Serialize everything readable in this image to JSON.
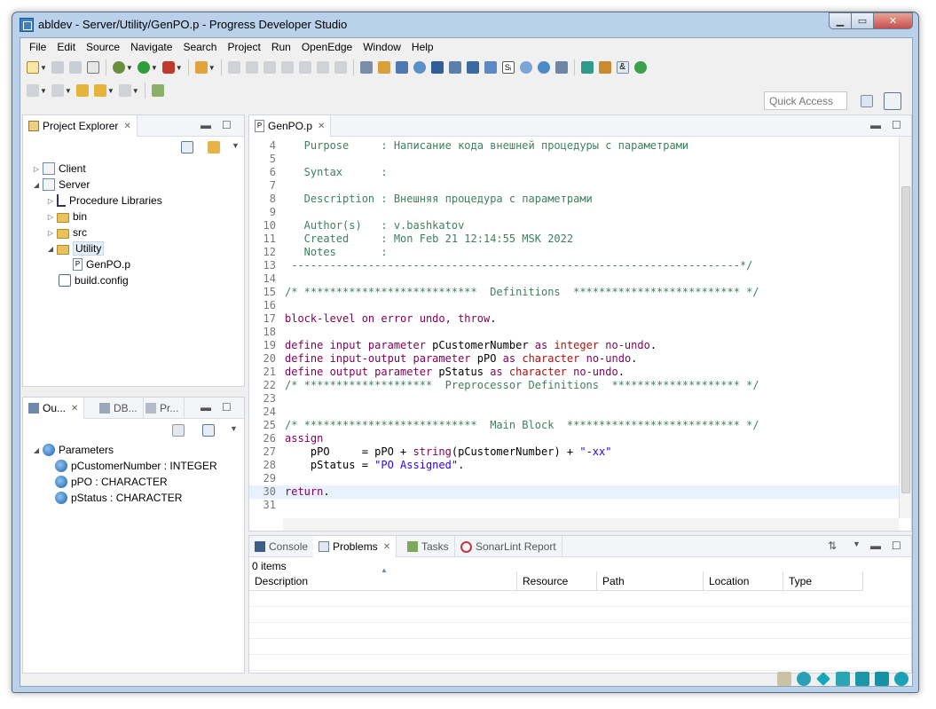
{
  "window": {
    "title": "abldev - Server/Utility/GenPO.p - Progress Developer Studio"
  },
  "menu": [
    "File",
    "Edit",
    "Source",
    "Navigate",
    "Search",
    "Project",
    "Run",
    "OpenEdge",
    "Window",
    "Help"
  ],
  "quick_access": {
    "placeholder": "Quick Access"
  },
  "project_explorer": {
    "tab_label": "Project Explorer",
    "items": [
      {
        "label": "Client"
      },
      {
        "label": "Server"
      },
      {
        "label": "Procedure Libraries"
      },
      {
        "label": "bin"
      },
      {
        "label": "src"
      },
      {
        "label": "Utility"
      },
      {
        "label": "GenPO.p"
      },
      {
        "label": "build.config"
      }
    ]
  },
  "outline": {
    "tabs": [
      "Ou...",
      "DB...",
      "Pr..."
    ],
    "items": [
      {
        "label": "Parameters"
      },
      {
        "label": "pCustomerNumber : INTEGER"
      },
      {
        "label": "pPO : CHARACTER"
      },
      {
        "label": "pStatus : CHARACTER"
      }
    ]
  },
  "editor": {
    "tab_label": "GenPO.p",
    "lines": [
      {
        "n": "4",
        "parts": [
          {
            "t": "   Purpose     : Написание кода внешней процедуры с параметрами",
            "c": "cm"
          }
        ]
      },
      {
        "n": "5",
        "parts": [
          {
            "t": "",
            "c": ""
          }
        ]
      },
      {
        "n": "6",
        "parts": [
          {
            "t": "   Syntax      :",
            "c": "cm"
          }
        ]
      },
      {
        "n": "7",
        "parts": [
          {
            "t": "",
            "c": ""
          }
        ]
      },
      {
        "n": "8",
        "parts": [
          {
            "t": "   Description : Внешняя процедура с параметрами",
            "c": "cm"
          }
        ]
      },
      {
        "n": "9",
        "parts": [
          {
            "t": "",
            "c": ""
          }
        ]
      },
      {
        "n": "10",
        "parts": [
          {
            "t": "   Author(s)   : v.bashkatov",
            "c": "cm"
          }
        ]
      },
      {
        "n": "11",
        "parts": [
          {
            "t": "   Created     : Mon Feb 21 12:14:55 MSK 2022",
            "c": "cm"
          }
        ]
      },
      {
        "n": "12",
        "parts": [
          {
            "t": "   Notes       :",
            "c": "cm"
          }
        ]
      },
      {
        "n": "13",
        "parts": [
          {
            "t": " ----------------------------------------------------------------------*/",
            "c": "cm"
          }
        ]
      },
      {
        "n": "14",
        "parts": [
          {
            "t": "",
            "c": ""
          }
        ]
      },
      {
        "n": "15",
        "parts": [
          {
            "t": "/* ***************************  Definitions  ************************** */",
            "c": "cm"
          }
        ]
      },
      {
        "n": "16",
        "parts": [
          {
            "t": "",
            "c": ""
          }
        ]
      },
      {
        "n": "17",
        "parts": [
          {
            "t": "block-level on error undo, throw",
            "c": "kw"
          },
          {
            "t": ".",
            "c": ""
          }
        ]
      },
      {
        "n": "18",
        "parts": [
          {
            "t": "",
            "c": ""
          }
        ]
      },
      {
        "n": "19",
        "parts": [
          {
            "t": "define input parameter ",
            "c": "kw"
          },
          {
            "t": "pCustomerNumber ",
            "c": ""
          },
          {
            "t": "as ",
            "c": "kw"
          },
          {
            "t": "integer",
            "c": "ty"
          },
          {
            "t": " no-undo",
            "c": "kw"
          },
          {
            "t": ".",
            "c": ""
          }
        ]
      },
      {
        "n": "20",
        "parts": [
          {
            "t": "define input-output parameter ",
            "c": "kw"
          },
          {
            "t": "pPO ",
            "c": ""
          },
          {
            "t": "as ",
            "c": "kw"
          },
          {
            "t": "character",
            "c": "ty"
          },
          {
            "t": " no-undo",
            "c": "kw"
          },
          {
            "t": ".",
            "c": ""
          }
        ]
      },
      {
        "n": "21",
        "parts": [
          {
            "t": "define output parameter ",
            "c": "kw"
          },
          {
            "t": "pStatus ",
            "c": ""
          },
          {
            "t": "as ",
            "c": "kw"
          },
          {
            "t": "character",
            "c": "ty"
          },
          {
            "t": " no-undo",
            "c": "kw"
          },
          {
            "t": ".",
            "c": ""
          }
        ]
      },
      {
        "n": "22",
        "parts": [
          {
            "t": "/* ********************  Preprocessor Definitions  ******************** */",
            "c": "cm"
          }
        ]
      },
      {
        "n": "23",
        "parts": [
          {
            "t": "",
            "c": ""
          }
        ]
      },
      {
        "n": "24",
        "parts": [
          {
            "t": "",
            "c": ""
          }
        ]
      },
      {
        "n": "25",
        "parts": [
          {
            "t": "/* ***************************  Main Block  *************************** */",
            "c": "cm"
          }
        ]
      },
      {
        "n": "26",
        "parts": [
          {
            "t": "assign",
            "c": "kw"
          }
        ]
      },
      {
        "n": "27",
        "parts": [
          {
            "t": "    pPO     = pPO + ",
            "c": ""
          },
          {
            "t": "string",
            "c": "kw"
          },
          {
            "t": "(pCustomerNumber) + ",
            "c": ""
          },
          {
            "t": "\"-xx\"",
            "c": "st"
          }
        ]
      },
      {
        "n": "28",
        "parts": [
          {
            "t": "    pStatus = ",
            "c": ""
          },
          {
            "t": "\"PO Assigned\"",
            "c": "st"
          },
          {
            "t": ".",
            "c": ""
          }
        ]
      },
      {
        "n": "29",
        "parts": [
          {
            "t": "",
            "c": ""
          }
        ]
      },
      {
        "n": "30",
        "parts": [
          {
            "t": "return",
            "c": "kw"
          },
          {
            "t": ".",
            "c": ""
          }
        ]
      },
      {
        "n": "31",
        "parts": [
          {
            "t": "",
            "c": ""
          }
        ]
      }
    ]
  },
  "bottom_panel": {
    "tabs": [
      "Console",
      "Problems",
      "Tasks",
      "SonarLint Report"
    ],
    "summary": "0 items",
    "columns": [
      "Description",
      "Resource",
      "Path",
      "Location",
      "Type"
    ]
  },
  "colors": {
    "comment": "#3f7f5f",
    "keyword": "#7f0055",
    "type": "#a31515",
    "string": "#2a00ff",
    "window_frame": "#b9d1ea"
  }
}
